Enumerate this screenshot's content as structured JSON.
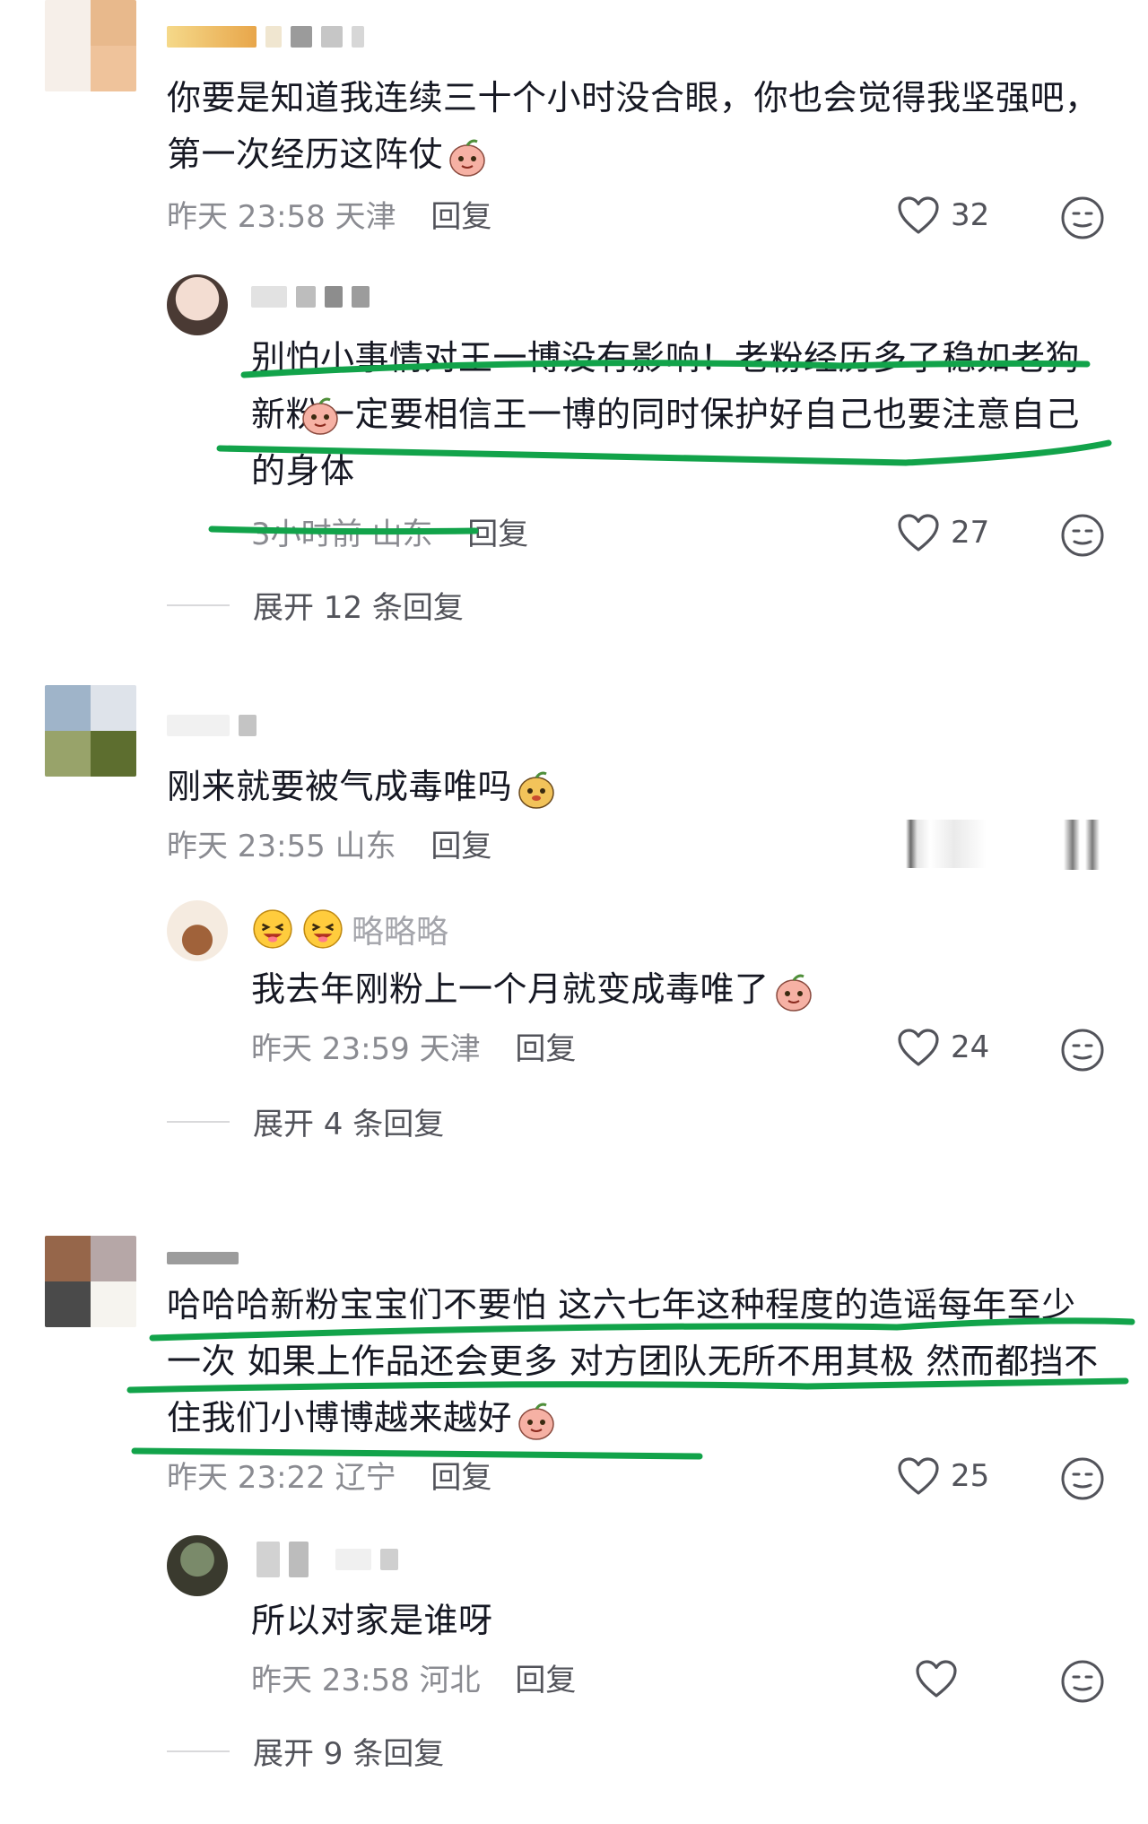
{
  "colors": {
    "highlight_green": "#12a34a",
    "meta_gray": "#8a8b91",
    "text": "#161823"
  },
  "comments": [
    {
      "text": "你要是知道我连续三十个小时没合眼，你也会觉得我坚强吧，第一次经历这阵仗",
      "time": "昨天 23:58",
      "location": "天津",
      "reply_label": "回复",
      "likes": "32",
      "reply": {
        "text": "别怕小事情对王一博没有影响！老粉经历多了稳如老狗新粉一定要相信王一博的同时保护好自己也要注意自己的身体",
        "time": "3小时前",
        "location": "山东",
        "reply_label": "回复",
        "likes": "27"
      },
      "expand_label": "展开 12 条回复"
    },
    {
      "text": "刚来就要被气成毒唯吗",
      "time": "昨天 23:55",
      "location": "山东",
      "reply_label": "回复",
      "reply": {
        "name": "略略略",
        "text": "我去年刚粉上一个月就变成毒唯了",
        "time": "昨天 23:59",
        "location": "天津",
        "reply_label": "回复",
        "likes": "24"
      },
      "expand_label": "展开 4 条回复"
    },
    {
      "text": "哈哈哈新粉宝宝们不要怕 这六七年这种程度的造谣每年至少一次 如果上作品还会更多 对方团队无所不用其极 然而都挡不住我们小博博越来越好",
      "time": "昨天 23:22",
      "location": "辽宁",
      "reply_label": "回复",
      "likes": "25",
      "reply": {
        "text": "所以对家是谁呀",
        "time": "昨天 23:58",
        "location": "河北",
        "reply_label": "回复"
      },
      "expand_label": "展开 9 条回复"
    }
  ]
}
